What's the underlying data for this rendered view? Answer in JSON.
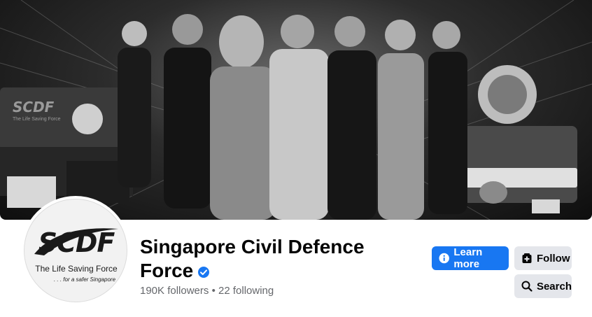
{
  "page": {
    "name": "Singapore Civil Defence Force",
    "followers": "190K followers",
    "separator": "•",
    "following": "22 following"
  },
  "profile_logo": {
    "wordmark": "SCDF",
    "tagline": "The Life Saving Force",
    "subtagline": ". . . for a safer Singapore"
  },
  "cover": {
    "vehicle_wordmark": "SCDF",
    "vehicle_tagline": "The Life Saving Force"
  },
  "actions": {
    "learn_more": "Learn more",
    "follow": "Follow",
    "search": "Search"
  },
  "colors": {
    "primary_button": "#1877f2",
    "secondary_button": "#e4e6eb",
    "verified_badge": "#1877f2"
  },
  "icons": {
    "learn_more": "info-icon",
    "follow": "follow-plus-icon",
    "search": "search-icon",
    "verified": "verified-badge-icon"
  }
}
